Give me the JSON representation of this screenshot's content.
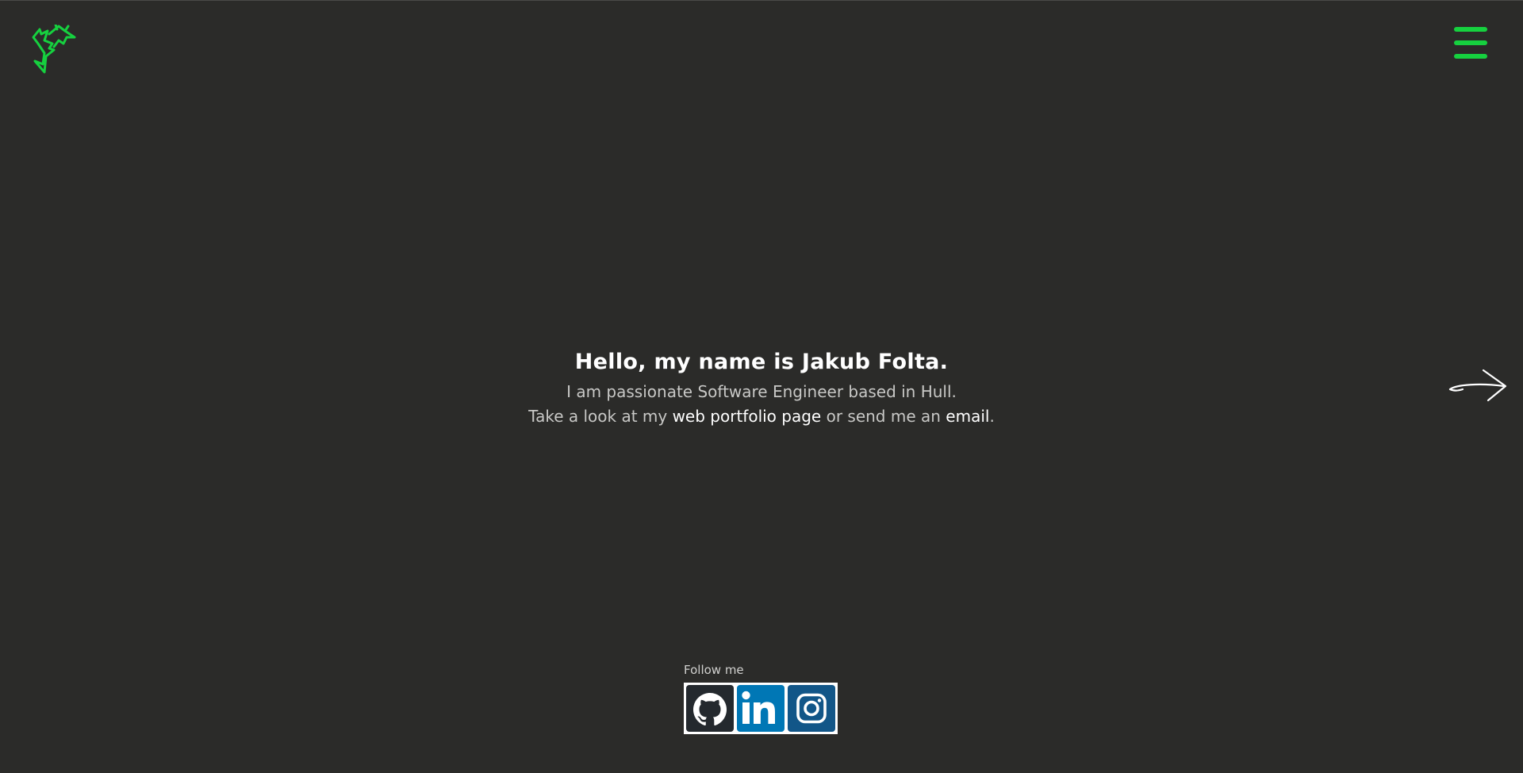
{
  "header": {
    "logo_icon": "green-thorn-logo",
    "menu_icon": "hamburger-menu-icon",
    "accent_color": "#16d13f"
  },
  "hero": {
    "title": "Hello, my name is Jakub Folta.",
    "line1": "I am passionate Software Engineer based in Hull.",
    "line2_prefix": "Take a look at my ",
    "portfolio_link": "web portfolio page",
    "line2_middle": " or send me an ",
    "email_link": "email",
    "line2_suffix": "."
  },
  "navigation": {
    "next_icon": "right-arrow-icon"
  },
  "social": {
    "label": "Follow me",
    "items": [
      {
        "name": "GitHub",
        "icon": "github-icon",
        "color": "#24292e"
      },
      {
        "name": "LinkedIn",
        "icon": "linkedin-icon",
        "color": "#0077b5"
      },
      {
        "name": "Instagram",
        "icon": "instagram-icon",
        "color": "#125688"
      }
    ]
  },
  "colors": {
    "background": "#2b2b29",
    "text": "#c8c8c6",
    "heading": "#ffffff"
  }
}
